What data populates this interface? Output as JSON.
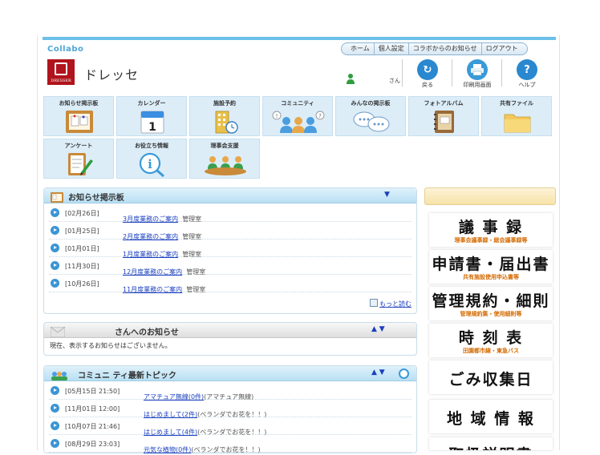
{
  "brand": "Collabo",
  "nav": [
    "ホーム",
    "個人設定",
    "コラボからのお知らせ",
    "ログアウト"
  ],
  "logo_text": "DRESSER",
  "site_name": "ドレッセ",
  "user_suffix": "さん",
  "header_buttons": [
    {
      "label": "戻る",
      "icon": "back-arrow-icon",
      "color": "#2a88d0"
    },
    {
      "label": "印刷用画面",
      "icon": "printer-icon",
      "color": "#3a9ad8"
    },
    {
      "label": "ヘルプ",
      "icon": "help-icon",
      "color": "#2a88d0"
    }
  ],
  "tiles": [
    {
      "label": "お知らせ掲示板",
      "icon": "bulletin-board-icon"
    },
    {
      "label": "カレンダー",
      "icon": "calendar-icon",
      "day": "1"
    },
    {
      "label": "施設予約",
      "icon": "facility-booking-icon"
    },
    {
      "label": "コミュニティ",
      "icon": "community-icon"
    },
    {
      "label": "みんなの掲示板",
      "icon": "chat-bubbles-icon"
    },
    {
      "label": "フォトアルバム",
      "icon": "photo-album-icon"
    },
    {
      "label": "共有ファイル",
      "icon": "folder-icon"
    },
    {
      "label": "アンケート",
      "icon": "survey-icon"
    },
    {
      "label": "お役立ち情報",
      "icon": "info-search-icon"
    },
    {
      "label": "理事会支援",
      "icon": "board-meeting-icon"
    }
  ],
  "notice_board": {
    "title": "お知らせ掲示板",
    "items": [
      {
        "date": "[02月26日]",
        "link": "3月度業務のご案内",
        "author": "管理室"
      },
      {
        "date": "[01月25日]",
        "link": "2月度業務のご案内",
        "author": "管理室"
      },
      {
        "date": "[01月01日]",
        "link": "1月度業務のご案内",
        "author": "管理室"
      },
      {
        "date": "[11月30日]",
        "link": "12月度業務のご案内",
        "author": "管理室"
      },
      {
        "date": "[10月26日]",
        "link": "11月度業務のご案内",
        "author": "管理室"
      }
    ],
    "more": "もっと読む"
  },
  "personal_notice": {
    "title": "さんへのお知らせ",
    "empty_message": "現在、表示するお知らせはございません。"
  },
  "community": {
    "title": "コミュニ ティ最新トピック",
    "items": [
      {
        "date": "[05月15日 21:50]",
        "link": "アマチュア無線(0件)",
        "group": "(アマチュア無線)"
      },
      {
        "date": "[11月01日 12:00]",
        "link": "はじめまして(2件)",
        "group": "(ベランダでお花を！！)"
      },
      {
        "date": "[10月07日 21:46]",
        "link": "はじめまして(4件)",
        "group": "(ベランダでお花を！！)"
      },
      {
        "date": "[08月29日 23:03]",
        "link": "元気な植物(0件)",
        "group": "(ベランダでお花を！！)"
      }
    ]
  },
  "side_buttons": [
    {
      "big": "議 事 録",
      "small": "理事会議事録・総会議事録等"
    },
    {
      "big": "申請書・届出書",
      "small": "共有施設使用申込書等"
    },
    {
      "big": "管理規約・細則",
      "small": "管理規約集・使用細則等"
    },
    {
      "big": "時 刻 表",
      "small": "田園都市線・東急バス"
    },
    {
      "big": "ごみ収集日",
      "small": ""
    },
    {
      "big": "地 域 情 報",
      "small": ""
    },
    {
      "big": "取扱説明書",
      "small": ""
    }
  ],
  "colors": {
    "accent": "#6cc0ea",
    "link": "#1a3fbf",
    "side_small": "#d46a00"
  }
}
